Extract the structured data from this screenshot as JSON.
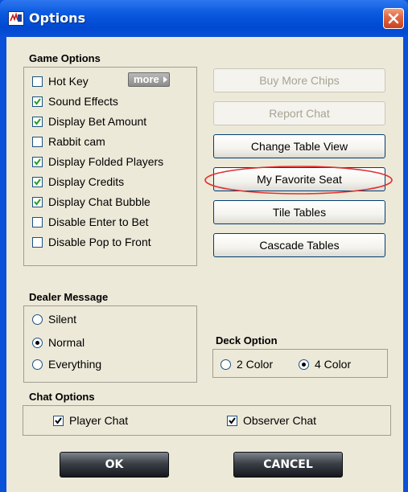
{
  "window": {
    "title": "Options",
    "icon": "app-logo-icon",
    "close_icon": "close-icon"
  },
  "game_options": {
    "label": "Game Options",
    "more_label": "more",
    "items": [
      {
        "label": "Hot Key",
        "checked": false
      },
      {
        "label": "Sound Effects",
        "checked": true
      },
      {
        "label": "Display Bet Amount",
        "checked": true
      },
      {
        "label": "Rabbit cam",
        "checked": false
      },
      {
        "label": "Display Folded Players",
        "checked": true
      },
      {
        "label": "Display Credits",
        "checked": true
      },
      {
        "label": "Display Chat Bubble",
        "checked": true
      },
      {
        "label": "Disable Enter to Bet",
        "checked": false
      },
      {
        "label": "Disable Pop to Front",
        "checked": false
      }
    ]
  },
  "action_buttons": [
    {
      "label": "Buy More Chips",
      "enabled": false
    },
    {
      "label": "Report Chat",
      "enabled": false
    },
    {
      "label": "Change Table View",
      "enabled": true
    },
    {
      "label": "My Favorite Seat",
      "enabled": true,
      "highlighted": true
    },
    {
      "label": "Tile Tables",
      "enabled": true
    },
    {
      "label": "Cascade Tables",
      "enabled": true
    }
  ],
  "dealer_message": {
    "label": "Dealer Message",
    "options": [
      "Silent",
      "Normal",
      "Everything"
    ],
    "selected": "Normal"
  },
  "deck_option": {
    "label": "Deck Option",
    "options": [
      "2 Color",
      "4 Color"
    ],
    "selected": "4 Color"
  },
  "chat_options": {
    "label": "Chat Options",
    "items": [
      {
        "label": "Player Chat",
        "checked": true
      },
      {
        "label": "Observer Chat",
        "checked": true
      }
    ]
  },
  "footer": {
    "ok_label": "OK",
    "cancel_label": "CANCEL"
  },
  "colors": {
    "titlebar": "#0a50d8",
    "dialog_face": "#ece9d8",
    "highlight_ellipse": "#e03030",
    "close_button": "#d9542c"
  }
}
